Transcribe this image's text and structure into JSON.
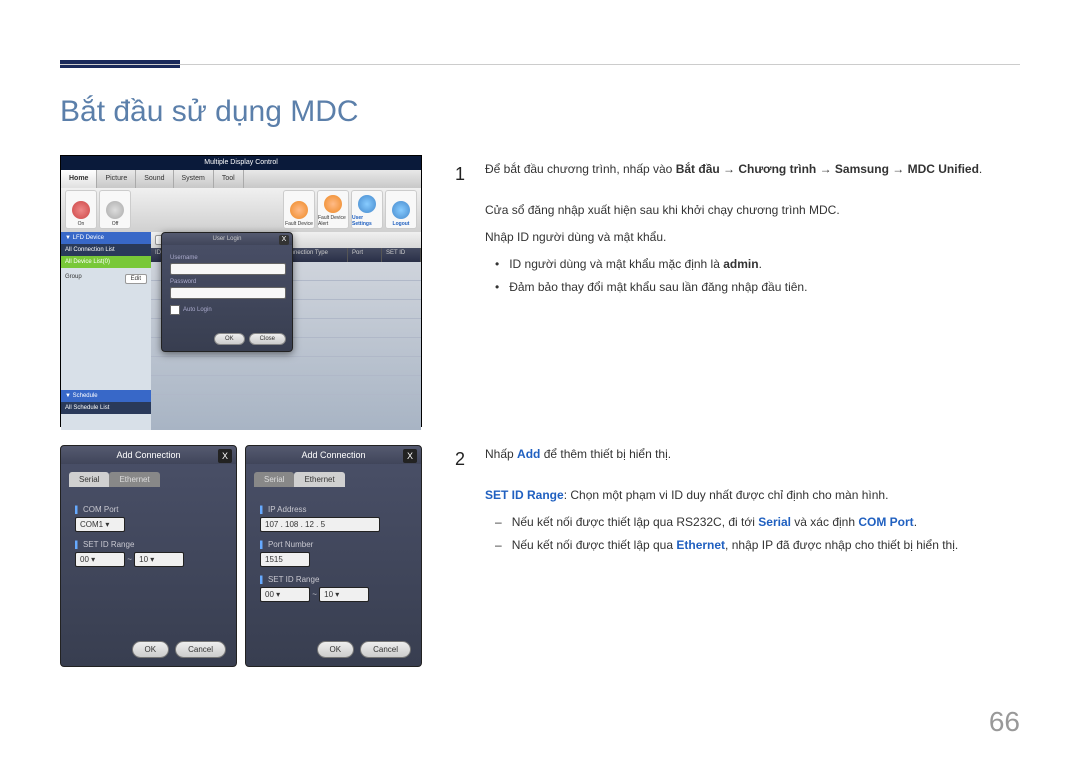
{
  "title": "Bắt đầu sử dụng MDC",
  "page_number": "66",
  "main_screenshot": {
    "window_title": "Multiple Display Control",
    "tabs": [
      "Home",
      "Picture",
      "Sound",
      "System",
      "Tool"
    ],
    "tabs_active": "Home",
    "toolbar_left": [
      "On",
      "Off"
    ],
    "toolbar_right": [
      "Fault Device",
      "Fault Device Alert",
      "User Settings",
      "Logout"
    ],
    "sidebar": {
      "lfd_header": "▼ LFD Device",
      "conn_header": "All Connection List",
      "device_header": "All Device List(0)",
      "group_label": "Group",
      "edit_btn": "Edit",
      "schedule_header": "▼ Schedule",
      "schedule_list": "All Schedule List"
    },
    "subtoolbar": {
      "add": "Add"
    },
    "grid_cols": [
      "ID",
      "Connection Type",
      "Port",
      "SET ID"
    ],
    "login_dialog": {
      "title": "User Login",
      "username_label": "Username",
      "password_label": "Password",
      "auto_login": "Auto Login",
      "ok": "OK",
      "close": "Close"
    }
  },
  "add_serial": {
    "title": "Add Connection",
    "tab_serial": "Serial",
    "tab_ethernet": "Ethernet",
    "com_port_label": "COM Port",
    "com_port_value": "COM1",
    "setid_label": "SET ID Range",
    "setid_from": "00",
    "setid_sep": "~",
    "setid_to": "10",
    "ok": "OK",
    "cancel": "Cancel"
  },
  "add_ethernet": {
    "title": "Add Connection",
    "tab_serial": "Serial",
    "tab_ethernet": "Ethernet",
    "ip_label": "IP Address",
    "ip_value": "107 . 108 . 12 . 5",
    "port_label": "Port Number",
    "port_value": "1515",
    "setid_label": "SET ID Range",
    "setid_from": "00",
    "setid_sep": "~",
    "setid_to": "10",
    "ok": "OK",
    "cancel": "Cancel"
  },
  "step1": {
    "num": "1",
    "text_pre": "Để bắt đầu chương trình, nhấp vào ",
    "path": "Bắt đầu → Chương trình → Samsung → MDC Unified",
    "para1": "Cửa sổ đăng nhập xuất hiện sau khi khởi chạy chương trình MDC.",
    "para2": "Nhập ID người dùng và mật khẩu.",
    "bullet1_pre": "ID người dùng và mật khẩu mặc định là ",
    "bullet1_bold": "admin",
    "bullet1_post": ".",
    "bullet2": "Đảm bảo thay đổi mật khẩu sau lần đăng nhập đầu tiên."
  },
  "step2": {
    "num": "2",
    "text_pre": "Nhấp ",
    "add": "Add",
    "text_post": " để thêm thiết bị hiển thị.",
    "setid_label": "SET ID Range",
    "setid_text": ": Chọn một phạm vi ID duy nhất được chỉ định cho màn hình.",
    "dash1_pre": "Nếu kết nối được thiết lập qua RS232C, đi tới ",
    "dash1_serial": "Serial",
    "dash1_mid": " và xác định ",
    "dash1_com": "COM Port",
    "dash1_post": ".",
    "dash2_pre": "Nếu kết nối được thiết lập qua ",
    "dash2_eth": "Ethernet",
    "dash2_post": ", nhập IP đã được nhập cho thiết bị hiển thị."
  }
}
